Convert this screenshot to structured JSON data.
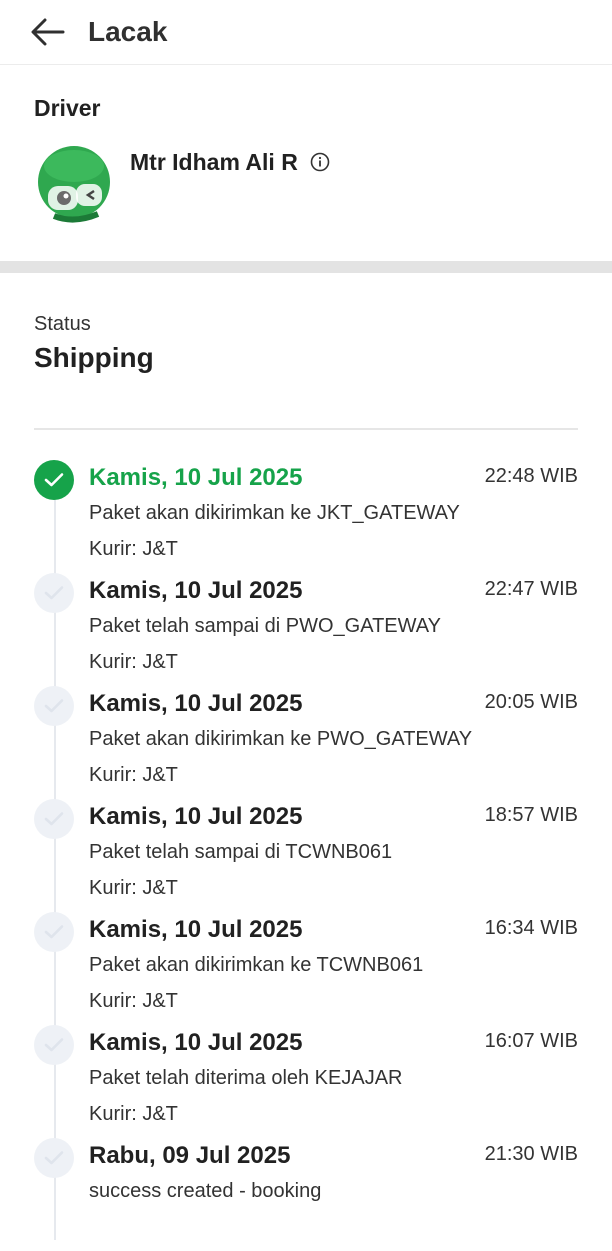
{
  "header": {
    "title": "Lacak"
  },
  "driver": {
    "heading": "Driver",
    "name": "Mtr Idham Ali R"
  },
  "status": {
    "label": "Status",
    "value": "Shipping"
  },
  "events": [
    {
      "date": "Kamis, 10 Jul 2025",
      "time": "22:48 WIB",
      "desc": "Paket akan dikirimkan ke JKT_GATEWAY",
      "courier": "Kurir: J&T",
      "active": true
    },
    {
      "date": "Kamis, 10 Jul 2025",
      "time": "22:47 WIB",
      "desc": "Paket telah sampai di PWO_GATEWAY",
      "courier": "Kurir: J&T",
      "active": false
    },
    {
      "date": "Kamis, 10 Jul 2025",
      "time": "20:05 WIB",
      "desc": "Paket akan dikirimkan ke PWO_GATEWAY",
      "courier": "Kurir: J&T",
      "active": false
    },
    {
      "date": "Kamis, 10 Jul 2025",
      "time": "18:57 WIB",
      "desc": "Paket telah sampai di TCWNB061",
      "courier": "Kurir: J&T",
      "active": false
    },
    {
      "date": "Kamis, 10 Jul 2025",
      "time": "16:34 WIB",
      "desc": "Paket akan dikirimkan ke TCWNB061",
      "courier": "Kurir: J&T",
      "active": false
    },
    {
      "date": "Kamis, 10 Jul 2025",
      "time": "16:07 WIB",
      "desc": "Paket telah diterima oleh KEJAJAR",
      "courier": "Kurir: J&T",
      "active": false
    },
    {
      "date": "Rabu, 09 Jul 2025",
      "time": "21:30 WIB",
      "desc": "success created - booking",
      "courier": "",
      "active": false
    }
  ],
  "colors": {
    "accent": "#16a34a",
    "inactive_dot": "#eef1f6",
    "divider": "#e3e3e3"
  },
  "icons": {
    "back": "arrow-left-icon",
    "info": "info-icon",
    "check": "check-icon",
    "avatar": "driver-helmet-avatar"
  }
}
